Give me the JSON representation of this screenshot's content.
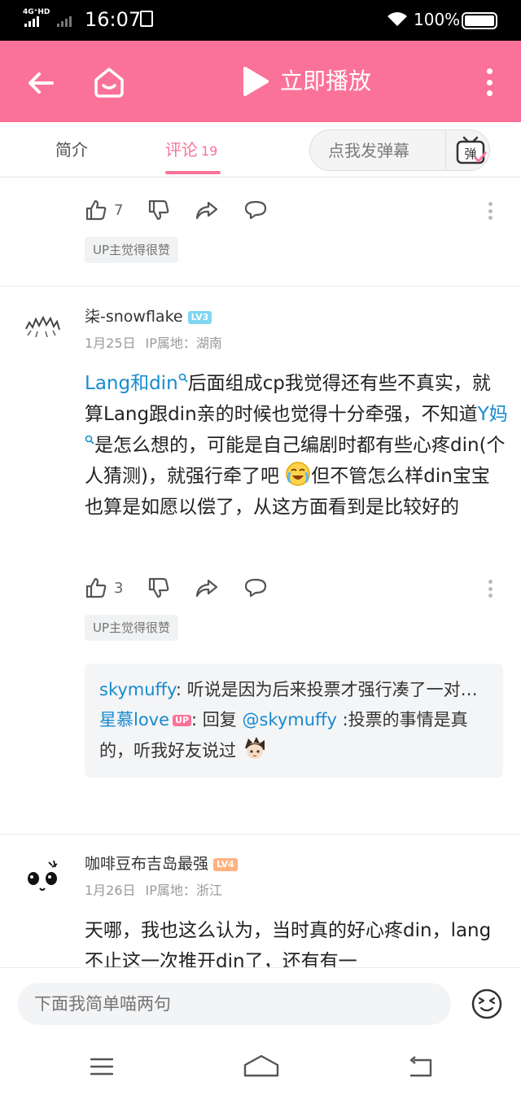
{
  "status_bar": {
    "network": "4G⁺HD",
    "network2": "HD",
    "time": "16:07",
    "battery": "100%"
  },
  "header": {
    "title": "立即播放"
  },
  "tabs": {
    "intro": "简介",
    "comments": "评论",
    "comments_count": "19",
    "danmaku_placeholder": "点我发弹幕",
    "danmaku_icon_text": "弹"
  },
  "comment_top": {
    "likes": "7",
    "tag": "UP主觉得很赞"
  },
  "comment_1": {
    "username": "柒-snowflake",
    "level": "LV3",
    "level_color": "#7fd6f0",
    "date": "1月25日",
    "ip": "IP属地：湖南",
    "text_link1": "Lang和din",
    "text_part1": "后面组成cp我觉得还有些不真实，就算Lang跟din亲的时候也觉得十分牵强，不知道",
    "text_link2": "Y妈",
    "text_part2": "是怎么想的，可能是自己编剧时都有些心疼din(个人猜测)，就强行牵了吧",
    "text_part3": "但不管怎么样din宝宝也算是如愿以偿了，从这方面看到是比较好的",
    "likes": "3",
    "tag": "UP主觉得很赞",
    "reply1_name": "skymuffy",
    "reply1_text": ": 听说是因为后来投票才强行凑了一对…",
    "reply2_name": "星慕love",
    "reply2_badge": "UP",
    "reply2_text_a": ": 回复 ",
    "reply2_mention": "@skymuffy",
    "reply2_text_b": " :投票的事情是真的，听我好友说过"
  },
  "comment_2": {
    "username": "咖啡豆布吉岛最强",
    "level": "LV4",
    "level_color": "#ffb27f",
    "date": "1月26日",
    "ip": "IP属地：浙江",
    "text": "天哪，我也这么认为，当时真的好心疼din，lang不止这一次推开din了，还有有一"
  },
  "input_bar": {
    "placeholder": "下面我简单喵两句"
  },
  "colors": {
    "brand_pink": "#fb7299",
    "link_blue": "#178bcf"
  }
}
